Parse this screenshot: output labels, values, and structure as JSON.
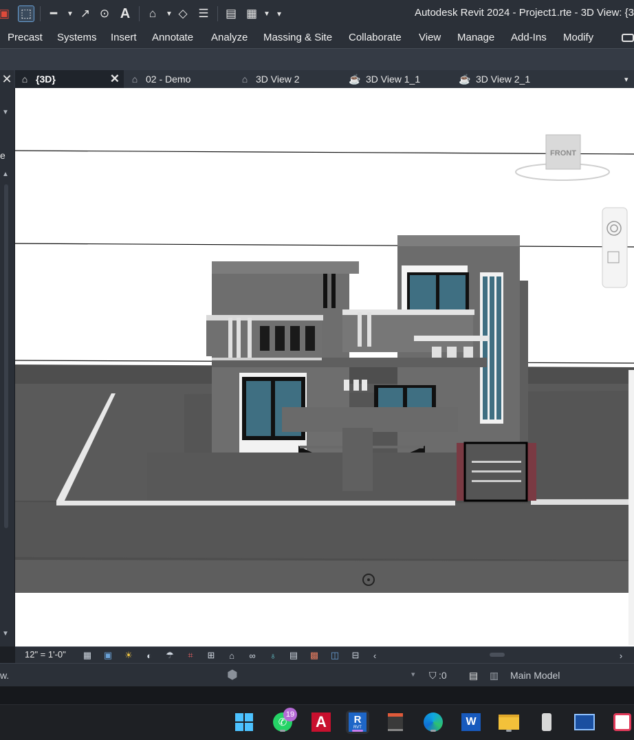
{
  "window": {
    "title": "Autodesk Revit 2024 - Project1.rte - 3D View: {3"
  },
  "ribbon": {
    "tabs": [
      "Precast",
      "Systems",
      "Insert",
      "Annotate",
      "Analyze",
      "Massing & Site",
      "Collaborate",
      "View",
      "Manage",
      "Add-Ins",
      "Modify"
    ]
  },
  "view_tabs": [
    {
      "label": "{3D}",
      "active": true
    },
    {
      "label": "02 - Demo",
      "active": false
    },
    {
      "label": "3D View 2",
      "active": false
    },
    {
      "label": "3D View 1_1",
      "active": false
    },
    {
      "label": "3D View 2_1",
      "active": false
    }
  ],
  "viewcube": {
    "face": "FRONT"
  },
  "view_control_bar": {
    "scale": "12\" = 1'-0\""
  },
  "status_bar": {
    "left_text": "w.",
    "selection_count": ":0",
    "model": "Main Model"
  },
  "taskbar": {
    "whatsapp_badge": "19",
    "revit_label": "R",
    "revit_sub": "RVT",
    "autocad_label": "A",
    "word_label": "W"
  },
  "colors": {
    "accent_revit": "#1e66c7",
    "autocad_red": "#c8102e",
    "window_glass": "#3f6f82",
    "stair_frame": "#7a3a43"
  }
}
